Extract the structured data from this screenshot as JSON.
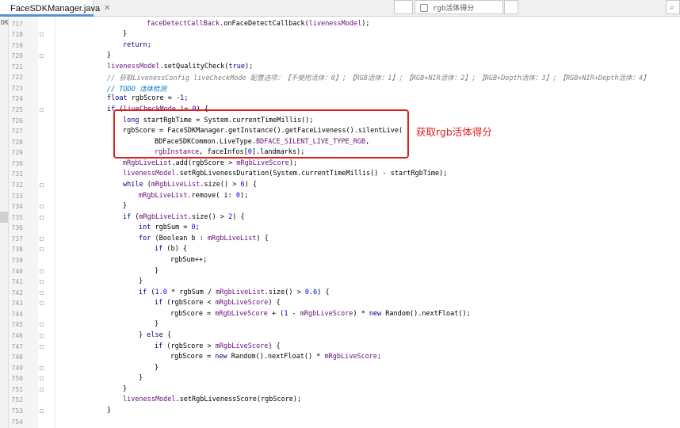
{
  "tab": {
    "title": "FaceSDKManager.java",
    "close_icon": "close-icon",
    "file_icon": "java-class-icon"
  },
  "toolbar": {
    "run_config_text": "rgb活体得分"
  },
  "left_panel": {
    "label": "DK"
  },
  "annotation": {
    "text": "获取rgb活体得分",
    "color": "#e02020"
  },
  "colors": {
    "keyword": "#000080",
    "field": "#660e7a",
    "number": "#0000ff",
    "comment": "#808080",
    "todo": "#0073bf",
    "highlight_box": "#e02020"
  },
  "code": [
    {
      "n": "717",
      "indent": 5,
      "text": "faceDetectCallBack.onFaceDetectCallback(livenessModel);"
    },
    {
      "n": "718",
      "indent": 2,
      "text": "}"
    },
    {
      "n": "719",
      "indent": 2,
      "text": "return;"
    },
    {
      "n": "720",
      "indent": 0,
      "text": "}"
    },
    {
      "n": "721",
      "indent": 0,
      "text": "livenessModel.setQualityCheck(true);"
    },
    {
      "n": "722",
      "indent": 0,
      "text": "// 获取LivenessConfig liveCheckMode 配置选项：【不使用活体：0】；【RGB活体：1】；【RGB+NIR活体：2】；【RGB+Depth活体：3】；【RGB+NIR+Depth活体：4】"
    },
    {
      "n": "723",
      "indent": 0,
      "text": "// TODO 活体检测"
    },
    {
      "n": "724",
      "indent": 0,
      "text": "float rgbScore = -1;"
    },
    {
      "n": "725",
      "indent": 0,
      "text": "if (liveCheckMode != 0) {"
    },
    {
      "n": "726",
      "indent": 2,
      "text": "long startRgbTime = System.currentTimeMillis();"
    },
    {
      "n": "727",
      "indent": 2,
      "text": "rgbScore = FaceSDKManager.getInstance().getFaceLiveness().silentLive("
    },
    {
      "n": "728",
      "indent": 6,
      "text": "BDFaceSDKCommon.LiveType.BDFACE_SILENT_LIVE_TYPE_RGB,"
    },
    {
      "n": "729",
      "indent": 6,
      "text": "rgbInstance, faceInfos[0].landmarks);"
    },
    {
      "n": "730",
      "indent": 2,
      "text": "mRgbLiveList.add(rgbScore > mRgbLiveScore);"
    },
    {
      "n": "731",
      "indent": 2,
      "text": "livenessModel.setRgbLivenessDuration(System.currentTimeMillis() - startRgbTime);"
    },
    {
      "n": "732",
      "indent": 2,
      "text": "while (mRgbLiveList.size() > 6) {"
    },
    {
      "n": "733",
      "indent": 4,
      "text": "mRgbLiveList.remove( i: 0);"
    },
    {
      "n": "734",
      "indent": 2,
      "text": "}"
    },
    {
      "n": "735",
      "indent": 2,
      "text": "if (mRgbLiveList.size() > 2) {"
    },
    {
      "n": "736",
      "indent": 4,
      "text": "int rgbSum = 0;"
    },
    {
      "n": "737",
      "indent": 4,
      "text": "for (Boolean b : mRgbLiveList) {"
    },
    {
      "n": "738",
      "indent": 6,
      "text": "if (b) {"
    },
    {
      "n": "739",
      "indent": 8,
      "text": "rgbSum++;"
    },
    {
      "n": "740",
      "indent": 6,
      "text": "}"
    },
    {
      "n": "741",
      "indent": 4,
      "text": "}"
    },
    {
      "n": "742",
      "indent": 4,
      "text": "if (1.0 * rgbSum / mRgbLiveList.size() > 0.6) {"
    },
    {
      "n": "743",
      "indent": 6,
      "text": "if (rgbScore < mRgbLiveScore) {"
    },
    {
      "n": "744",
      "indent": 8,
      "text": "rgbScore = mRgbLiveScore + (1 - mRgbLiveScore) * new Random().nextFloat();"
    },
    {
      "n": "745",
      "indent": 6,
      "text": "}"
    },
    {
      "n": "746",
      "indent": 4,
      "text": "} else {"
    },
    {
      "n": "747",
      "indent": 6,
      "text": "if (rgbScore > mRgbLiveScore) {"
    },
    {
      "n": "748",
      "indent": 8,
      "text": "rgbScore = new Random().nextFloat() * mRgbLiveScore;"
    },
    {
      "n": "749",
      "indent": 6,
      "text": "}"
    },
    {
      "n": "750",
      "indent": 4,
      "text": "}"
    },
    {
      "n": "751",
      "indent": 2,
      "text": "}"
    },
    {
      "n": "752",
      "indent": 2,
      "text": "livenessModel.setRgbLivenessScore(rgbScore);"
    },
    {
      "n": "753",
      "indent": 0,
      "text": "}"
    },
    {
      "n": "754",
      "indent": 0,
      "text": ""
    }
  ]
}
